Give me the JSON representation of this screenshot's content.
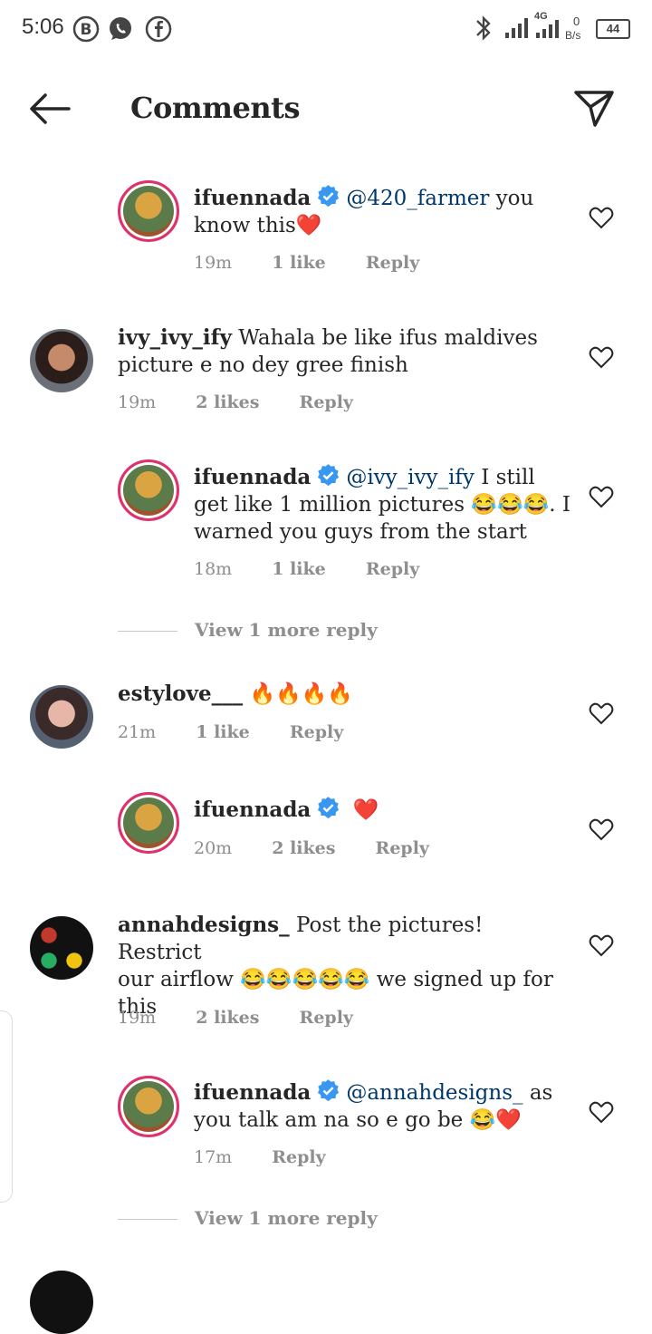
{
  "status_bar": {
    "time": "5:06",
    "network": "4G",
    "speed_value": "0",
    "speed_unit": "B/s",
    "battery": "44"
  },
  "header": {
    "title": "Comments"
  },
  "comments": [
    {
      "username": "ifuennada",
      "verified": true,
      "mention": "@420_farmer",
      "text_line1": " you",
      "text_line2": "know this",
      "emoji_after": "❤️",
      "time": "19m",
      "likes": "1 like",
      "reply": "Reply",
      "is_reply": true
    },
    {
      "username": "ivy_ivy_ify",
      "verified": false,
      "text_line1": "Wahala be like ifus maldives",
      "text_line2": "picture e no dey gree finish",
      "time": "19m",
      "likes": "2 likes",
      "reply": "Reply",
      "is_reply": false
    },
    {
      "username": "ifuennada",
      "verified": true,
      "mention": "@ivy_ivy_ify",
      "text_line1": " I still",
      "text_line2": "get like 1 million pictures 😂😂😂. I",
      "text_line3": "warned you guys from the start",
      "time": "18m",
      "likes": "1 like",
      "reply": "Reply",
      "is_reply": true
    },
    {
      "username": "estylove___",
      "verified": false,
      "text_line1": "🔥🔥🔥🔥",
      "time": "21m",
      "likes": "1 like",
      "reply": "Reply",
      "is_reply": false
    },
    {
      "username": "ifuennada",
      "verified": true,
      "text_line1": "❤️",
      "time": "20m",
      "likes": "2 likes",
      "reply": "Reply",
      "is_reply": true
    },
    {
      "username": "annahdesigns_",
      "verified": false,
      "text_line1": "Post the pictures! Restrict",
      "text_line2": "our airflow 😂😂😂😂😂 we signed up for",
      "text_line3": "this",
      "time": "19m",
      "likes": "2 likes",
      "reply": "Reply",
      "is_reply": false
    },
    {
      "username": "ifuennada",
      "verified": true,
      "mention": "@annahdesigns_",
      "text_line1": " as",
      "text_line2": "you talk am na so e go be 😂❤️",
      "time": "17m",
      "reply": "Reply",
      "is_reply": true
    }
  ],
  "view_more": [
    {
      "label": "View 1 more reply"
    },
    {
      "label": "View 1 more reply"
    }
  ],
  "colors": {
    "text": "#262626",
    "muted": "#8e8e8e",
    "mention": "#00376b",
    "verified": "#3897f0",
    "story_ring": "#e1306c"
  }
}
